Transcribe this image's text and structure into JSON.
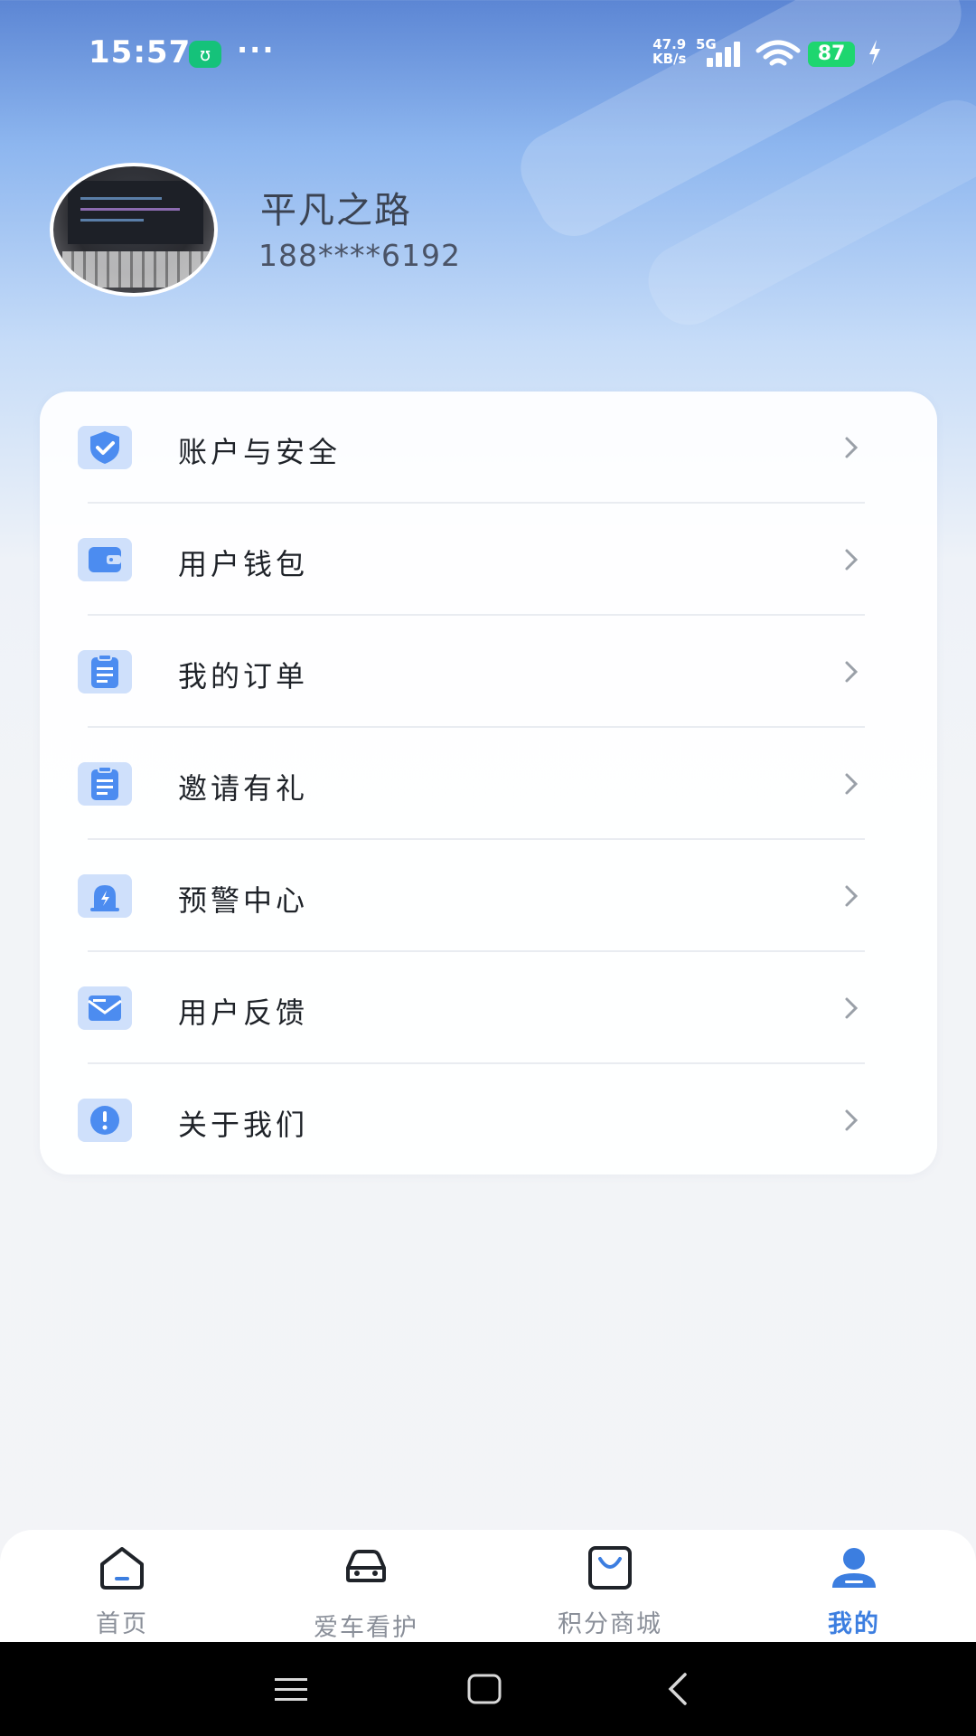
{
  "status_bar": {
    "time": "15:57",
    "app_badge": "ʊ",
    "more": "···",
    "net_speed_value": "47.9",
    "net_speed_unit": "KB/s",
    "network": "5G",
    "battery": "87"
  },
  "profile": {
    "username": "平凡之路",
    "phone": "188****6192"
  },
  "menu": [
    {
      "label": "账户与安全",
      "icon": "shield-check-icon"
    },
    {
      "label": "用户钱包",
      "icon": "wallet-icon"
    },
    {
      "label": "我的订单",
      "icon": "clipboard-icon"
    },
    {
      "label": "邀请有礼",
      "icon": "clipboard-icon"
    },
    {
      "label": "预警中心",
      "icon": "alarm-icon"
    },
    {
      "label": "用户反馈",
      "icon": "mail-icon"
    },
    {
      "label": "关于我们",
      "icon": "info-icon"
    }
  ],
  "tabs": [
    {
      "label": "首页",
      "icon": "home-icon"
    },
    {
      "label": "爱车看护",
      "icon": "car-icon"
    },
    {
      "label": "积分商城",
      "icon": "shopping-bag-icon"
    },
    {
      "label": "我的",
      "icon": "user-icon",
      "active": true
    }
  ],
  "colors": {
    "accent": "#3c7ee0",
    "icon_bg": "#cfe0fb",
    "icon_fg": "#4c8cf0",
    "battery": "#1ed66f"
  }
}
